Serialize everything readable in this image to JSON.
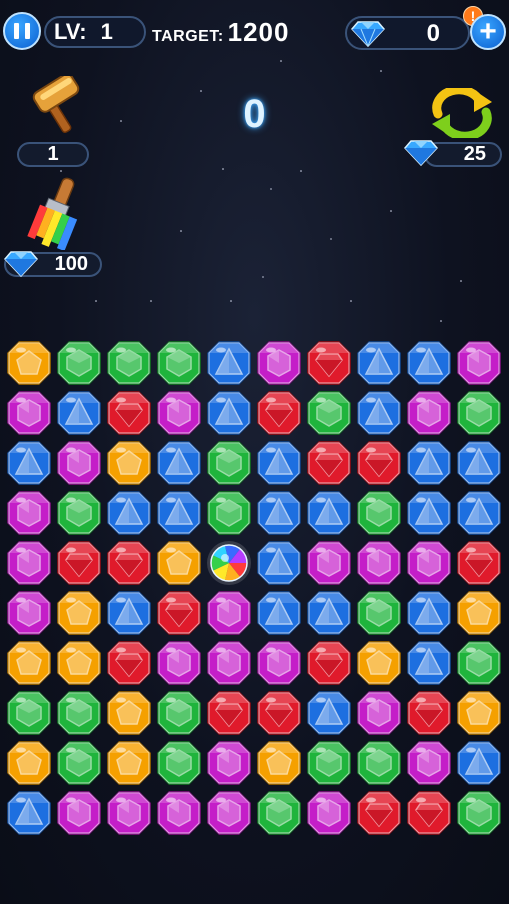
{
  "hud": {
    "level_label": "LV:",
    "level_value": "1",
    "target_label": "TARGET:",
    "target_value": "1200",
    "gems_count": "0",
    "alert_badge": "!",
    "plus_label": "+"
  },
  "score": "0",
  "boosters": {
    "hammer_count": "1",
    "shuffle_cost": "25",
    "brush_cost": "100"
  },
  "colors": {
    "orange": "#f5a000",
    "green": "#1fb43c",
    "red": "#e01a2b",
    "blue": "#1d6fe0",
    "purple": "#c41ec8"
  },
  "board": {
    "rows": 10,
    "cols": 10,
    "cell_key": {
      "O": "orange",
      "G": "green",
      "R": "red",
      "B": "blue",
      "P": "purple",
      "X": "rainbow"
    },
    "cells": [
      "OGGGBPRBBP",
      "PBRPBRGBPG",
      "BPOBGBRRBB",
      "PGBBGBBGBB",
      "PRROXBPPPR",
      "POBRPBBGBO",
      "OORPPPROBG",
      "GGOGRRBPRO",
      "OGOGPOGGPB",
      "BPPPPGPRRG"
    ]
  }
}
